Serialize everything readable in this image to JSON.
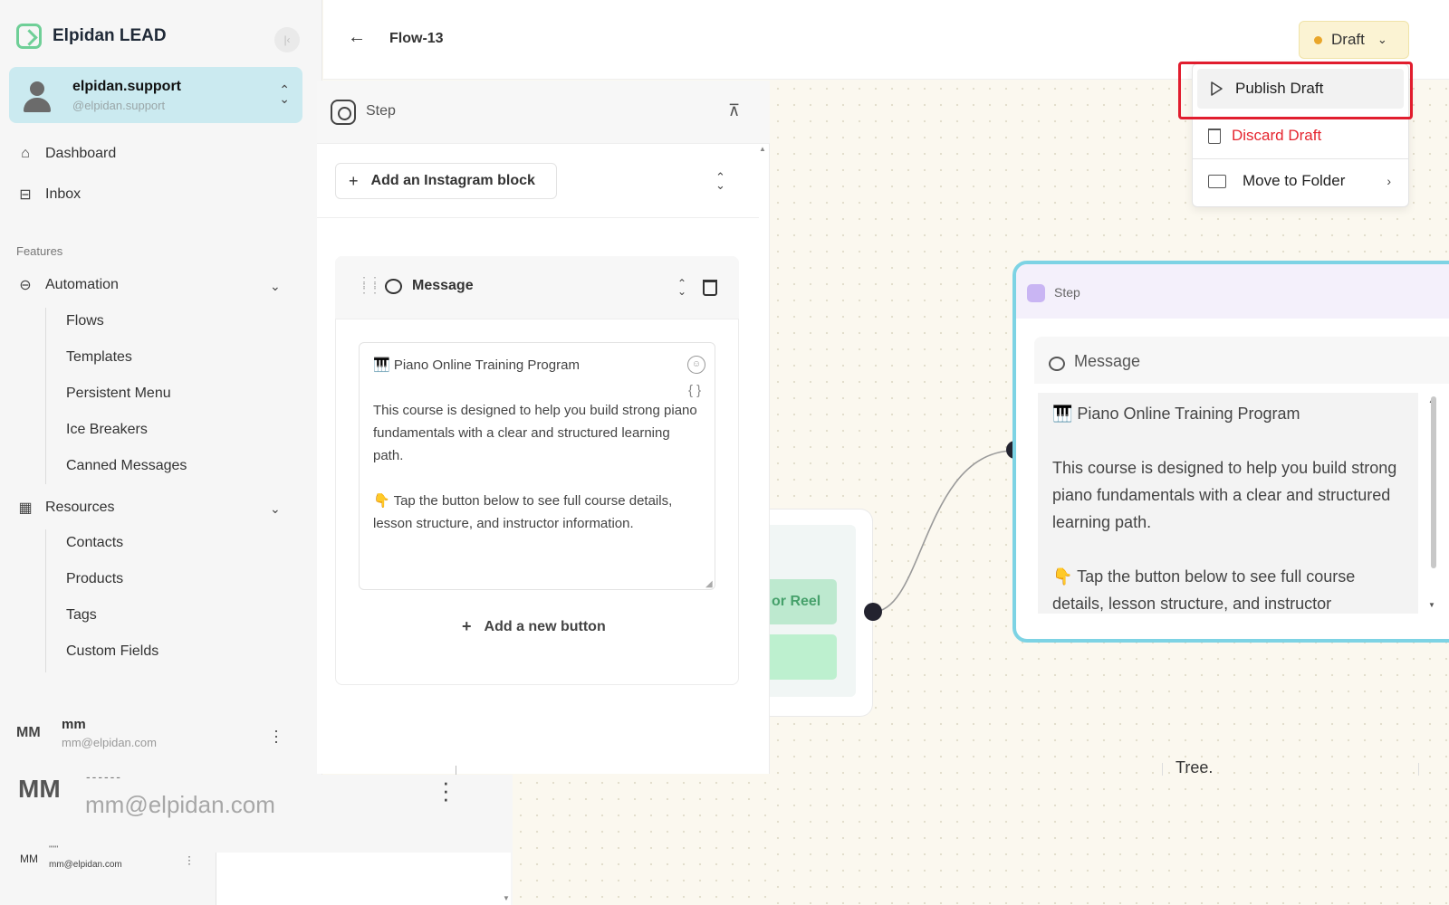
{
  "brand": {
    "name": "Elpidan LEAD",
    "collapse_icon": "collapse-left-icon"
  },
  "account": {
    "name": "elpidan.support",
    "handle": "@elpidan.support"
  },
  "nav": {
    "dashboard": "Dashboard",
    "inbox": "Inbox",
    "features_label": "Features",
    "automation": "Automation",
    "automation_items": [
      "Flows",
      "Templates",
      "Persistent Menu",
      "Ice Breakers",
      "Canned Messages"
    ],
    "resources": "Resources",
    "resources_items": [
      "Contacts",
      "Products",
      "Tags",
      "Custom Fields"
    ]
  },
  "user": {
    "initials": "MM",
    "name": "mm",
    "email": "mm@elpidan.com"
  },
  "zoom": {
    "initials": "MM",
    "dashes": "------",
    "email": "mm@elpidan.com"
  },
  "mini": {
    "initials": "MM",
    "dash": "''''''",
    "email": "mm@elpidan.com"
  },
  "header": {
    "flow_title": "Flow-13",
    "status": "Draft",
    "status_color": "#e9a62a"
  },
  "editor": {
    "step_label": "Step",
    "add_block_label": "Add an Instagram block",
    "message_title": "Message",
    "message_text": "🎹 Piano Online Training Program\n\nThis course is designed to help you build strong piano fundamentals with a clear and structured learning path.\n\n👇 Tap the button below to see full course details, lesson structure, and instructor information.",
    "emoji_icon": "{ }",
    "add_button_label": "Add a new button"
  },
  "canvas": {
    "prev_button_label": "or Reel",
    "node_step_label": "Step",
    "node_message_title": "Message",
    "node_text": "🎹 Piano Online Training Program\n\nThis course is designed to help you build strong piano fundamentals with a clear and structured learning path.\n\n👇 Tap the button below to see full course details, lesson structure, and instructor",
    "tree_text": "Tree."
  },
  "dropdown": {
    "publish": "Publish Draft",
    "discard": "Discard Draft",
    "move": "Move to Folder",
    "discard_color": "#e5252f",
    "highlight_color": "#e11d2e"
  },
  "colors": {
    "accent_green": "#6fcf97",
    "account_bg": "#cbeaf0",
    "node_border": "#7dd3e4"
  }
}
